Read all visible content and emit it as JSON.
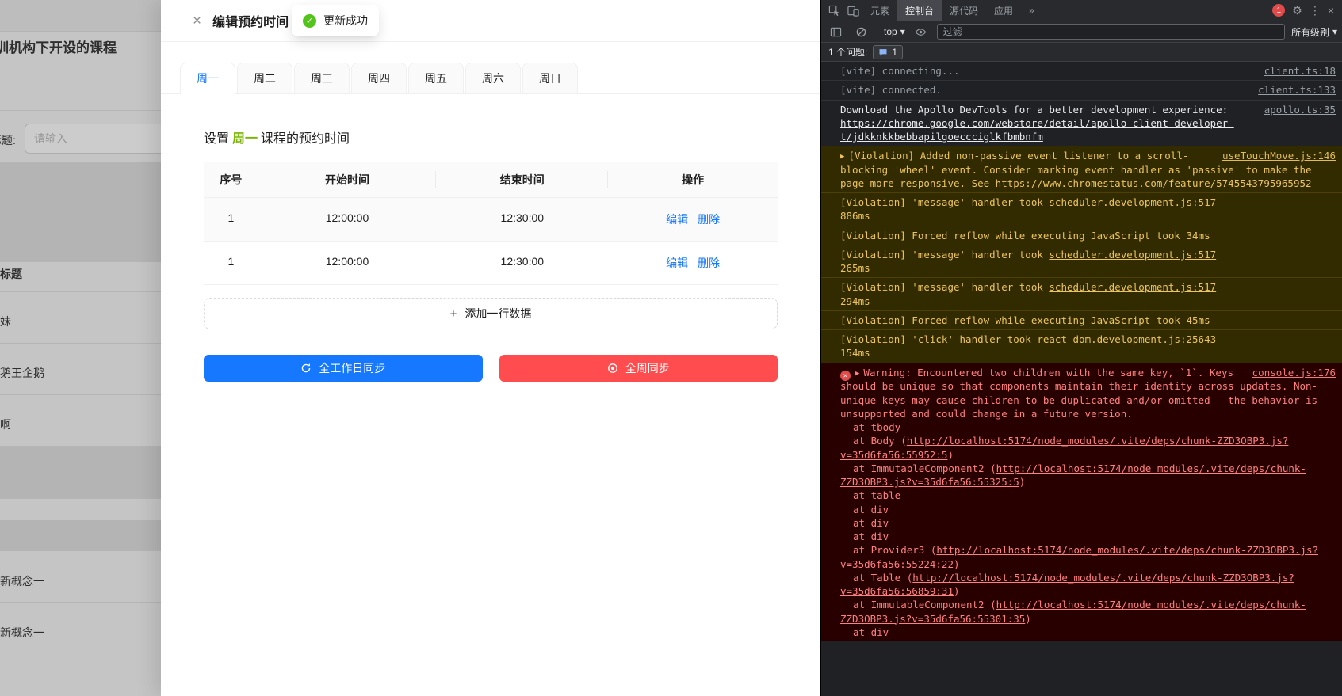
{
  "colors": {
    "primary_blue": "#1677ff",
    "danger_red": "#ff4d4f",
    "success_green": "#52c41a",
    "highlight_green": "#7cb305",
    "devtools_bg": "#202124",
    "warn_bg": "#332b00",
    "error_bg": "#290000"
  },
  "icons": {
    "close": "×",
    "check": "✓",
    "plus": "+",
    "gear": "⚙",
    "dots": "⋮",
    "chevron_down": "▾",
    "expand_arrow": "▶",
    "error_x": "✕",
    "more_tabs": "»"
  },
  "background_page": {
    "title_fragment": "训机构下开设的课程",
    "form_label_fragment": "程标题:",
    "input_placeholder": "请输入",
    "table_header_fragment": "标题",
    "row_fragments": [
      "妹",
      "鹅王企鹅",
      "啊",
      "新概念一",
      "新概念一"
    ]
  },
  "toast": {
    "text": "更新成功"
  },
  "drawer": {
    "title": "编辑预约时间",
    "tabs": [
      "周一",
      "周二",
      "周三",
      "周四",
      "周五",
      "周六",
      "周日"
    ],
    "active_tab": "周一",
    "subtitle": {
      "prefix": "设置",
      "highlight": "周一",
      "suffix": "课程的预约时间"
    },
    "table": {
      "columns": [
        "序号",
        "开始时间",
        "结束时间",
        "操作"
      ],
      "rows": [
        {
          "no": "1",
          "start": "12:00:00",
          "end": "12:30:00",
          "edit": "编辑",
          "delete": "删除"
        },
        {
          "no": "1",
          "start": "12:00:00",
          "end": "12:30:00",
          "edit": "编辑",
          "delete": "删除"
        }
      ]
    },
    "add_row_label": "添加一行数据",
    "workday_sync_label": "全工作日同步",
    "week_sync_label": "全周同步"
  },
  "devtools": {
    "tabs": [
      "元素",
      "控制台",
      "源代码",
      "应用"
    ],
    "active_tab": "控制台",
    "error_badge": "1",
    "toolbar": {
      "context": "top",
      "filter_placeholder": "过滤",
      "levels": "所有级别"
    },
    "issues": {
      "label": "1 个问题:",
      "count": "1"
    },
    "messages": [
      {
        "text": "[vite] connecting...",
        "source": "client.ts:18"
      },
      {
        "text": "[vite] connected.",
        "source": "client.ts:133"
      },
      {
        "text": "Download the Apollo DevTools for a better development experience: ",
        "url": "https://chrome.google.com/webstore/detail/apollo-client-developer-t/jdkknkkbebbapilgoeccciglkfbmbnfm",
        "source": "apollo.ts:35"
      },
      {
        "text": "[Violation] Added non-passive event listener to a scroll-blocking 'wheel' event. Consider marking event handler as 'passive' to make the page more responsive. See ",
        "url": "https://www.chromestatus.com/feature/5745543795965952",
        "source": "useTouchMove.js:146"
      },
      {
        "text": "[Violation] 'message' handler took ",
        "link": "scheduler.development.js:517",
        "suffix": "\n886ms"
      },
      {
        "text": "[Violation] Forced reflow while executing JavaScript took 34ms"
      },
      {
        "text": "[Violation] 'message' handler took ",
        "link": "scheduler.development.js:517",
        "suffix": "\n265ms"
      },
      {
        "text": "[Violation] 'message' handler took ",
        "link": "scheduler.development.js:517",
        "suffix": "\n294ms"
      },
      {
        "text": "[Violation] Forced reflow while executing JavaScript took 45ms"
      },
      {
        "text": "[Violation] 'click' handler took ",
        "link": "react-dom.development.js:25643",
        "suffix": "\n154ms"
      },
      {
        "text": "Warning: Encountered two children with the same key, `1`. Keys should be unique so that components maintain their identity across updates. Non-unique keys may cause children to be duplicated and/or omitted — the behavior is unsupported and could change in a future version.",
        "source": "console.js:176"
      }
    ],
    "stack": [
      {
        "pre": "at tbody"
      },
      {
        "pre": "at Body (",
        "link": "http://localhost:5174/node_modules/.vite/deps/chunk-ZZD3OBP3.js?v=35d6fa56:55952:5",
        "post": ")"
      },
      {
        "pre": "at ImmutableComponent2 (",
        "link": "http://localhost:5174/node_modules/.vite/deps/chunk-ZZD3OBP3.js?v=35d6fa56:55325:5",
        "post": ")"
      },
      {
        "pre": "at table"
      },
      {
        "pre": "at div"
      },
      {
        "pre": "at div"
      },
      {
        "pre": "at div"
      },
      {
        "pre": "at Provider3 (",
        "link": "http://localhost:5174/node_modules/.vite/deps/chunk-ZZD3OBP3.js?v=35d6fa56:55224:22",
        "post": ")"
      },
      {
        "pre": "at Table (",
        "link": "http://localhost:5174/node_modules/.vite/deps/chunk-ZZD3OBP3.js?v=35d6fa56:56859:31",
        "post": ")"
      },
      {
        "pre": "at ImmutableComponent2 (",
        "link": "http://localhost:5174/node_modules/.vite/deps/chunk-ZZD3OBP3.js?v=35d6fa56:55301:35",
        "post": ")"
      },
      {
        "pre": "at div"
      }
    ]
  }
}
